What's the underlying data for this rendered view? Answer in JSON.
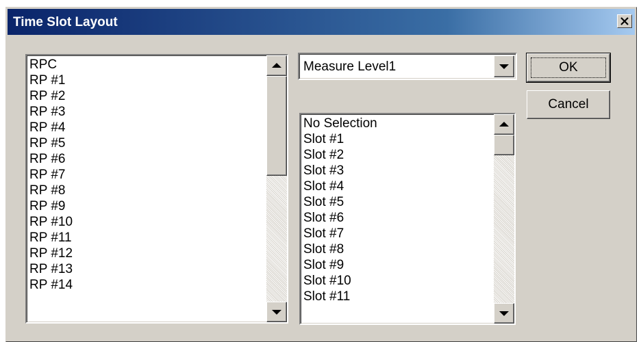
{
  "dialog": {
    "title": "Time Slot Layout",
    "close_icon": "close-x-icon"
  },
  "rp_list": {
    "items": [
      "RPC",
      "RP #1",
      "RP #2",
      "RP #3",
      "RP #4",
      "RP #5",
      "RP #6",
      "RP #7",
      "RP #8",
      "RP #9",
      "RP #10",
      "RP #11",
      "RP #12",
      "RP #13",
      "RP #14"
    ]
  },
  "measure_combo": {
    "selected": "Measure Level1"
  },
  "slot_list": {
    "items": [
      "No Selection",
      "Slot #1",
      "Slot #2",
      "Slot #3",
      "Slot #4",
      "Slot #5",
      "Slot #6",
      "Slot #7",
      "Slot #8",
      "Slot #9",
      "Slot #10",
      "Slot #11"
    ]
  },
  "buttons": {
    "ok_label": "OK",
    "cancel_label": "Cancel"
  },
  "colors": {
    "titlebar_start": "#0a246a",
    "titlebar_end": "#a6caf0",
    "face": "#d4d0c8"
  }
}
